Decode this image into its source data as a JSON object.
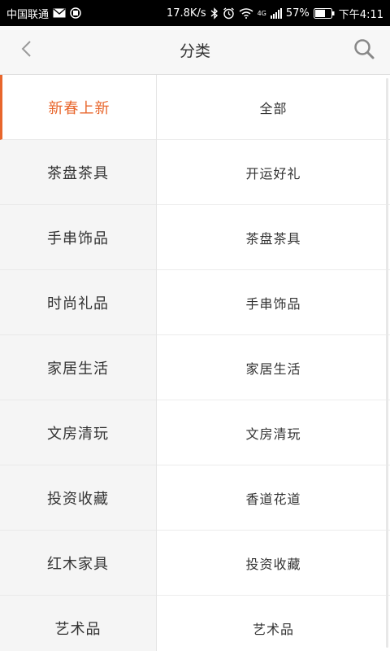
{
  "status_bar": {
    "carrier": "中国联通",
    "speed": "17.8K/s",
    "network": "4G",
    "battery": "57%",
    "time": "下午4:11"
  },
  "header": {
    "title": "分类"
  },
  "left_menu": [
    {
      "label": "新春上新"
    },
    {
      "label": "茶盘茶具"
    },
    {
      "label": "手串饰品"
    },
    {
      "label": "时尚礼品"
    },
    {
      "label": "家居生活"
    },
    {
      "label": "文房清玩"
    },
    {
      "label": "投资收藏"
    },
    {
      "label": "红木家具"
    },
    {
      "label": "艺术品"
    }
  ],
  "right_menu": [
    {
      "label": "全部"
    },
    {
      "label": "开运好礼"
    },
    {
      "label": "茶盘茶具"
    },
    {
      "label": "手串饰品"
    },
    {
      "label": "家居生活"
    },
    {
      "label": "文房清玩"
    },
    {
      "label": "香道花道"
    },
    {
      "label": "投资收藏"
    },
    {
      "label": "艺术品"
    }
  ],
  "colors": {
    "accent": "#e8662c",
    "sidebar_bg": "#f5f5f5",
    "header_bg": "#f7f7f7"
  },
  "icons": {
    "back": "chevron-left-icon",
    "search": "search-icon"
  }
}
